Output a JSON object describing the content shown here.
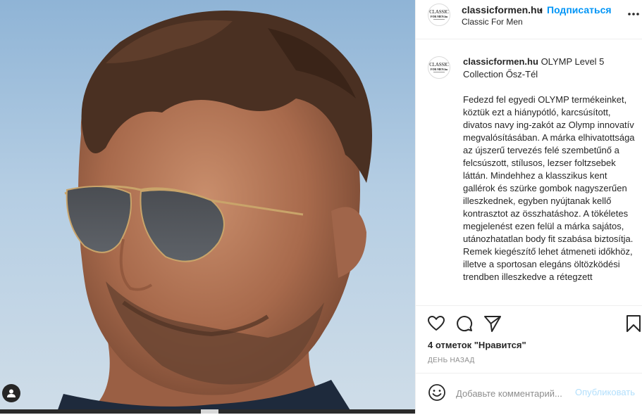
{
  "photo": {
    "alt_icon": "user-tag-icon"
  },
  "header": {
    "avatar_line1": "CLASSIC",
    "avatar_line2": "FOR MEN.hu",
    "username": "classicformen.hu",
    "separator": "•",
    "follow_label": "Подписаться",
    "location": "Classic For Men",
    "more_icon": "more-horizontal-icon"
  },
  "caption": {
    "username": "classicformen.hu",
    "title": "OLYMP Level 5 Collection Ősz-Tél",
    "body": "Fedezd fel egyedi OLYMP termékeinket, köztük ezt a hiánypótló, karcsúsított, divatos navy ing-zakót az Olymp innovatív megvalósításában. A márka elhivatottsága az újszerű tervezés felé szembetűnő a felcsúszott, stílusos, lezser foltzsebek láttán. Mindehhez a klasszikus kent gallérok és szürke gombok nagyszerűen illeszkednek, egyben nyújtanak kellő kontrasztot az összhatáshoz. A tökéletes megjelenést ezen felül a márka sajátos, utánozhatatlan body fit szabása biztosítja. Remek kiegészítő lehet átmeneti időkhöz, illetve a sportosan elegáns öltözködési trendben illeszkedve a rétegzett"
  },
  "actions": {
    "like_icon": "heart-icon",
    "comment_icon": "comment-icon",
    "share_icon": "paper-plane-icon",
    "save_icon": "bookmark-icon",
    "likes_count": "4 отметок",
    "likes_suffix": " \"Нравится\"",
    "timestamp": "ДЕНЬ НАЗАД"
  },
  "comment": {
    "emoji_icon": "smiley-icon",
    "placeholder": "Добавьте комментарий...",
    "publish_label": "Опубликовать"
  }
}
